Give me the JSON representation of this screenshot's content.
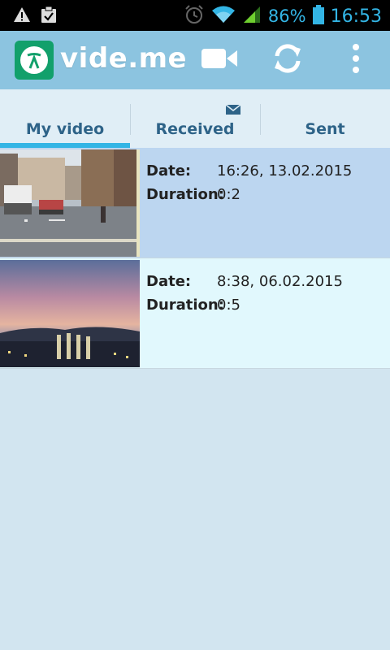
{
  "status_bar": {
    "battery_percent": "86%",
    "time": "16:53",
    "icons": [
      "warning-icon",
      "clipboard-check-icon",
      "alarm-icon",
      "wifi-icon",
      "signal-icon",
      "battery-icon"
    ]
  },
  "action_bar": {
    "app_title": "vide.me",
    "actions": [
      "video-camera-icon",
      "refresh-icon",
      "overflow-menu-icon"
    ]
  },
  "tabs": [
    {
      "label": "My video",
      "selected": true
    },
    {
      "label": "Received",
      "selected": false,
      "icon": "mail-icon"
    },
    {
      "label": "Sent",
      "selected": false
    }
  ],
  "videos": [
    {
      "date_label": "Date:",
      "date": "16:26, 13.02.2015",
      "duration_label": "Duration:",
      "duration": "0:2",
      "thumbnail": "street-scene"
    },
    {
      "date_label": "Date:",
      "date": "8:38, 06.02.2015",
      "duration_label": "Duration:",
      "duration": "0:5",
      "thumbnail": "sunset-cityscape"
    }
  ],
  "colors": {
    "accent": "#33b5e5",
    "action_bar": "#8cc4e0",
    "tab_text": "#2e6388",
    "background": "#d2e5f0",
    "selected_row": "#bcd6f0",
    "row": "#e1f8fd",
    "logo": "#12a06b"
  }
}
